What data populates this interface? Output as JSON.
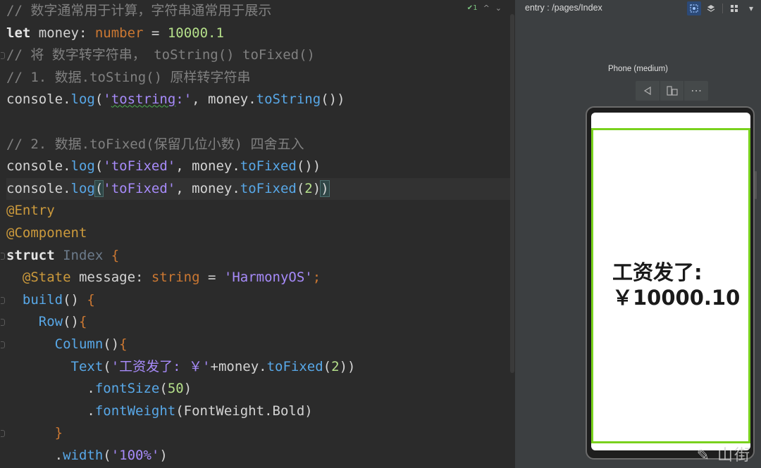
{
  "editor": {
    "inspection": {
      "count": "1",
      "check_icon": "check-icon",
      "up_icon": "chevron-up-icon",
      "down_icon": "chevron-down-icon"
    },
    "lines": [
      [
        {
          "c": "cm",
          "t": "// 数字通常用于计算，字符串通常用于展示"
        }
      ],
      [
        {
          "c": "kw",
          "t": "let"
        },
        {
          "c": "pn",
          "t": " money: "
        },
        {
          "c": "ty",
          "t": "number"
        },
        {
          "c": "pn",
          "t": " = "
        },
        {
          "c": "nu",
          "t": "10000.1"
        }
      ],
      [
        {
          "c": "cm",
          "t": "// 将 数字转字符串， toString() toFixed()"
        }
      ],
      [
        {
          "c": "cm",
          "t": "// 1. 数据.toSting() 原样转字符串"
        }
      ],
      [
        {
          "c": "pn",
          "t": "console."
        },
        {
          "c": "fn",
          "t": "log"
        },
        {
          "c": "pn",
          "t": "("
        },
        {
          "c": "st",
          "t": "'"
        },
        {
          "c": "st squig",
          "t": "tostring"
        },
        {
          "c": "st",
          "t": ":'"
        },
        {
          "c": "pn",
          "t": ", money."
        },
        {
          "c": "fn",
          "t": "toString"
        },
        {
          "c": "pn",
          "t": "())"
        }
      ],
      [],
      [
        {
          "c": "cm",
          "t": "// 2. 数据.toFixed(保留几位小数) 四舍五入"
        }
      ],
      [
        {
          "c": "pn",
          "t": "console."
        },
        {
          "c": "fn",
          "t": "log"
        },
        {
          "c": "pn",
          "t": "("
        },
        {
          "c": "st",
          "t": "'toFixed'"
        },
        {
          "c": "pn",
          "t": ", money."
        },
        {
          "c": "fn",
          "t": "toFixed"
        },
        {
          "c": "pn",
          "t": "())"
        }
      ],
      [
        {
          "c": "pn",
          "t": "console."
        },
        {
          "c": "fn",
          "t": "log"
        },
        {
          "c": "pn brace-hl",
          "t": "("
        },
        {
          "c": "st",
          "t": "'toFixed'"
        },
        {
          "c": "pn",
          "t": ", money."
        },
        {
          "c": "fn",
          "t": "toFixed"
        },
        {
          "c": "pn",
          "t": "("
        },
        {
          "c": "nu",
          "t": "2"
        },
        {
          "c": "pn",
          "t": ")"
        },
        {
          "c": "pn brace-hl",
          "t": ")"
        }
      ],
      [
        {
          "c": "an",
          "t": "@Entry"
        }
      ],
      [
        {
          "c": "an",
          "t": "@Component"
        }
      ],
      [
        {
          "c": "kw",
          "t": "struct"
        },
        {
          "c": "pn",
          "t": " "
        },
        {
          "c": "cl",
          "t": "Index"
        },
        {
          "c": "pn",
          "t": " "
        },
        {
          "c": "ty",
          "t": "{"
        }
      ],
      [
        {
          "c": "pn",
          "t": "  "
        },
        {
          "c": "an",
          "t": "@State"
        },
        {
          "c": "pn",
          "t": " message: "
        },
        {
          "c": "ty",
          "t": "string"
        },
        {
          "c": "pn",
          "t": " = "
        },
        {
          "c": "st",
          "t": "'HarmonyOS'"
        },
        {
          "c": "ty",
          "t": ";"
        }
      ],
      [
        {
          "c": "pn",
          "t": "  "
        },
        {
          "c": "fn",
          "t": "build"
        },
        {
          "c": "pn",
          "t": "() "
        },
        {
          "c": "ty",
          "t": "{"
        }
      ],
      [
        {
          "c": "pn",
          "t": "    "
        },
        {
          "c": "fn",
          "t": "Row"
        },
        {
          "c": "pn",
          "t": "()"
        },
        {
          "c": "ty",
          "t": "{"
        }
      ],
      [
        {
          "c": "pn",
          "t": "      "
        },
        {
          "c": "fn",
          "t": "Column"
        },
        {
          "c": "pn",
          "t": "()"
        },
        {
          "c": "ty",
          "t": "{"
        }
      ],
      [
        {
          "c": "pn",
          "t": "        "
        },
        {
          "c": "fn",
          "t": "Text"
        },
        {
          "c": "pn",
          "t": "("
        },
        {
          "c": "st",
          "t": "'工资发了: ￥'"
        },
        {
          "c": "pn",
          "t": "+money."
        },
        {
          "c": "fn",
          "t": "toFixed"
        },
        {
          "c": "pn",
          "t": "("
        },
        {
          "c": "nu",
          "t": "2"
        },
        {
          "c": "pn",
          "t": "))"
        }
      ],
      [
        {
          "c": "pn",
          "t": "          ."
        },
        {
          "c": "fn",
          "t": "fontSize"
        },
        {
          "c": "pn",
          "t": "("
        },
        {
          "c": "nu",
          "t": "50"
        },
        {
          "c": "pn",
          "t": ")"
        }
      ],
      [
        {
          "c": "pn",
          "t": "          ."
        },
        {
          "c": "fn",
          "t": "fontWeight"
        },
        {
          "c": "pn",
          "t": "(FontWeight.Bold)"
        }
      ],
      [
        {
          "c": "pn",
          "t": "      "
        },
        {
          "c": "ty",
          "t": "}"
        }
      ],
      [
        {
          "c": "pn",
          "t": "      ."
        },
        {
          "c": "fn",
          "t": "width"
        },
        {
          "c": "pn",
          "t": "("
        },
        {
          "c": "st",
          "t": "'100%'"
        },
        {
          "c": "pn",
          "t": ")"
        }
      ]
    ],
    "current_line": 8,
    "fold_lines": [
      2,
      11,
      13,
      14,
      15,
      19
    ]
  },
  "preview": {
    "path": "entry : /pages/Index",
    "device_label": "Phone (medium)",
    "text_line1": "工资发了:",
    "text_line2": "￥10000.10",
    "accent_color": "#79d11d",
    "watermark": "✎ 山街"
  }
}
